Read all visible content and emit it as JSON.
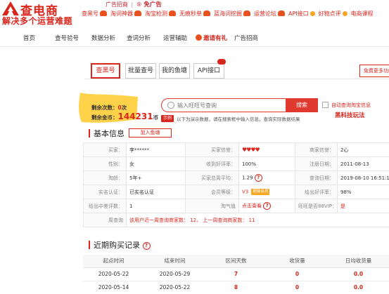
{
  "header": {
    "brand": "查电商",
    "slogan": "解决多个运营难题",
    "ad_label": "广告招商",
    "ad_free": "免广告",
    "top_links": [
      {
        "label": "查黑号",
        "mark": "hot"
      },
      {
        "label": "淘词神器",
        "mark": "hot"
      },
      {
        "label": "淘宝检测",
        "mark": "hot"
      },
      {
        "label": "无痕秒单",
        "mark": "hot"
      },
      {
        "label": "蓝海词挖掘",
        "mark": "hot"
      },
      {
        "label": "运营论坛",
        "mark": "hot"
      },
      {
        "label": "API接口",
        "mark": "dot"
      },
      {
        "label": "好物点评",
        "mark": "dot"
      },
      {
        "label": "电商课程",
        "mark": "none"
      }
    ]
  },
  "nav": {
    "items": [
      "首页",
      "查号验号",
      "数据分析",
      "查词分析",
      "运营辅助",
      "邀请有礼",
      "广告招商"
    ],
    "highlight_index": 5
  },
  "tabs": {
    "items": [
      "查黑号",
      "批量查号",
      "我的鱼塘",
      "API接口"
    ],
    "active_index": 0,
    "free_button": "免费更多功能"
  },
  "credit": {
    "times_label": "剩余次数：",
    "times_value": "0",
    "times_unit": "次",
    "coins_label": "剩余金币：",
    "coins_value": "144231",
    "coins_unit": "币"
  },
  "search": {
    "placeholder": "输入旺旺号查询",
    "button": "搜索",
    "auto_label": "自动查询淘宝信息",
    "black_tech": "黑科技玩法",
    "example_badge": "示例",
    "example_note": "以下为演示数据，请在搜索框中输入信息，查询实际数据结果"
  },
  "basic_info": {
    "title": "基本信息",
    "add_button": "加入鱼塘",
    "rows": [
      [
        {
          "k": "买家：",
          "v": "李******"
        },
        {
          "k": "买家信誉：",
          "v": "hearts"
        },
        {
          "k": "商家信誉：",
          "v": "2心"
        }
      ],
      [
        {
          "k": "性别：",
          "v": "女"
        },
        {
          "k": "收到好评率：",
          "v": "100%"
        },
        {
          "k": "注册日期：",
          "v": "2011-08-13"
        }
      ],
      [
        {
          "k": "淘龄：",
          "v": "5年+"
        },
        {
          "k": "买家总周平均：",
          "v": "1.29"
        },
        {
          "k": "查询日期：",
          "v": "2019-08-10 16:51:12"
        }
      ],
      [
        {
          "k": "实名认证：",
          "v": "已实名认证"
        },
        {
          "k": "会员等级：",
          "v": "V3"
        },
        {
          "k": "给出好评率：",
          "v": "98%"
        }
      ],
      [
        {
          "k": "给出中差评数：",
          "v": "1"
        },
        {
          "k": "淘气值",
          "v": "点击查看"
        },
        {
          "k": "旺旺是否88VIP：",
          "v": "是"
        }
      ]
    ],
    "level_tag": "超级会员",
    "summary_label": "周查询",
    "summary_text": "该用户近一周查询商家数：  12、 上一周查询商家数：  11"
  },
  "purchase": {
    "title": "近期购买记录",
    "columns": [
      "起点时间",
      "结束时间",
      "区间天数",
      "收货量",
      "日均收货量"
    ],
    "rows": [
      [
        "2020-05-22",
        "2020-05-29",
        "7",
        "0",
        "0.0"
      ],
      [
        "2020-05-14",
        "2020-05-22",
        "8",
        "0",
        "0.0"
      ]
    ]
  },
  "colors": {
    "accent": "#d9261c",
    "button": "#e0392f",
    "highlight": "#ffd24a"
  }
}
